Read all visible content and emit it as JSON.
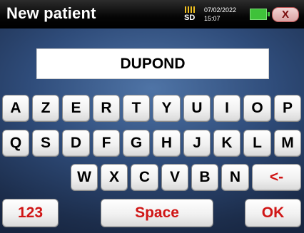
{
  "header": {
    "title": "New patient",
    "storage_label": "SD",
    "date": "07/02/2022",
    "time": "15:07",
    "close_label": "X"
  },
  "name_field": {
    "value": "DUPOND"
  },
  "keyboard": {
    "row1": [
      "A",
      "Z",
      "E",
      "R",
      "T",
      "Y",
      "U",
      "I",
      "O",
      "P"
    ],
    "row2": [
      "Q",
      "S",
      "D",
      "F",
      "G",
      "H",
      "J",
      "K",
      "L",
      "M"
    ],
    "row3": [
      "W",
      "X",
      "C",
      "V",
      "B",
      "N"
    ],
    "backspace_label": "<-",
    "numbers_label": "123",
    "space_label": "Space",
    "ok_label": "OK"
  },
  "colors": {
    "action_key_text": "#d01515",
    "battery": "#3fc23a"
  },
  "icons": [
    "sd-card-icon",
    "battery-icon",
    "close-icon"
  ]
}
